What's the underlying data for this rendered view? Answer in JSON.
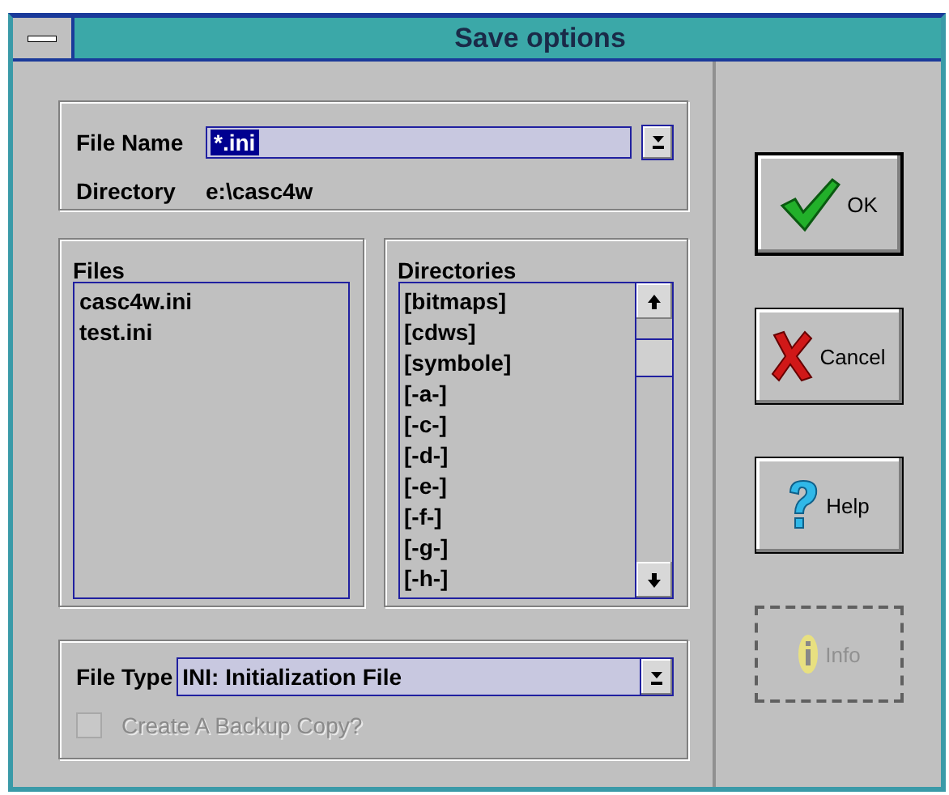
{
  "window": {
    "title": "Save options"
  },
  "file_name": {
    "label": "File Name",
    "value": "*.ini",
    "selected": true
  },
  "directory": {
    "label": "Directory",
    "value": "e:\\casc4w"
  },
  "files": {
    "label": "Files",
    "items": [
      {
        "name": "casc4w.ini",
        "selected": false
      },
      {
        "name": "test.ini",
        "selected": false
      }
    ]
  },
  "directories": {
    "label": "Directories",
    "items": [
      {
        "name": "[bitmaps]",
        "selected": false
      },
      {
        "name": "[cdws]",
        "selected": false
      },
      {
        "name": "[symbole]",
        "selected": false
      },
      {
        "name": "[-a-]",
        "selected": false
      },
      {
        "name": "[-c-]",
        "selected": false
      },
      {
        "name": "[-d-]",
        "selected": false
      },
      {
        "name": "[-e-]",
        "selected": false
      },
      {
        "name": "[-f-]",
        "selected": false
      },
      {
        "name": "[-g-]",
        "selected": false
      },
      {
        "name": "[-h-]",
        "selected": false
      }
    ]
  },
  "file_type": {
    "label": "File Type",
    "value": "INI: Initialization File"
  },
  "backup": {
    "label": "Create A Backup Copy?",
    "checked": false,
    "disabled": true
  },
  "buttons": [
    {
      "kind": "ok",
      "label": "OK",
      "default": true,
      "disabled": false
    },
    {
      "kind": "cancel",
      "label": "Cancel",
      "default": false,
      "disabled": false
    },
    {
      "kind": "help",
      "label": "Help",
      "default": false,
      "disabled": false
    },
    {
      "kind": "info",
      "label": "Info",
      "default": false,
      "disabled": true
    }
  ]
}
